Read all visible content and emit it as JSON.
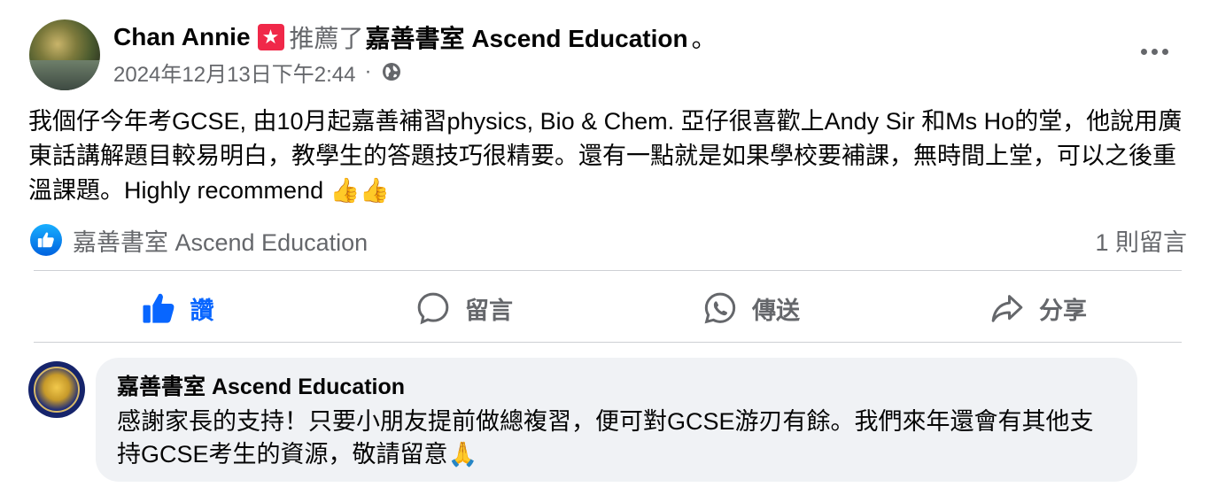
{
  "post": {
    "author": "Chan Annie",
    "recommend_icon": "recommend-flag-icon",
    "recommend_text": "推薦了",
    "page_name": "嘉善書室 Ascend Education",
    "trailing_period": "。",
    "date": "2024年12月13日下午2:44",
    "meta_separator": "·",
    "privacy_icon": "globe-icon",
    "body": "我個仔今年考GCSE, 由10月起嘉善補習physics, Bio & Chem. 亞仔很喜歡上Andy Sir 和Ms Ho的堂，他說用廣東話講解題目較易明白，教學生的答題技巧很精要。還有一點就是如果學校要補課，無時間上堂，可以之後重溫課題。Highly recommend 👍👍"
  },
  "reactions": {
    "icon": "like-reaction-icon",
    "names": "嘉善書室 Ascend Education",
    "comment_count": "1 則留言"
  },
  "actions": {
    "like": "讚",
    "comment": "留言",
    "send": "傳送",
    "share": "分享"
  },
  "comment": {
    "author": "嘉善書室 Ascend Education",
    "text": "感謝家長的支持！只要小朋友提前做總複習，便可對GCSE游刃有餘。我們來年還會有其他支持GCSE考生的資源，敬請留意🙏"
  },
  "colors": {
    "accent_blue": "#0866ff",
    "secondary_text": "#65676b",
    "bubble_bg": "#f0f2f5",
    "recommend_red": "#f02849"
  }
}
